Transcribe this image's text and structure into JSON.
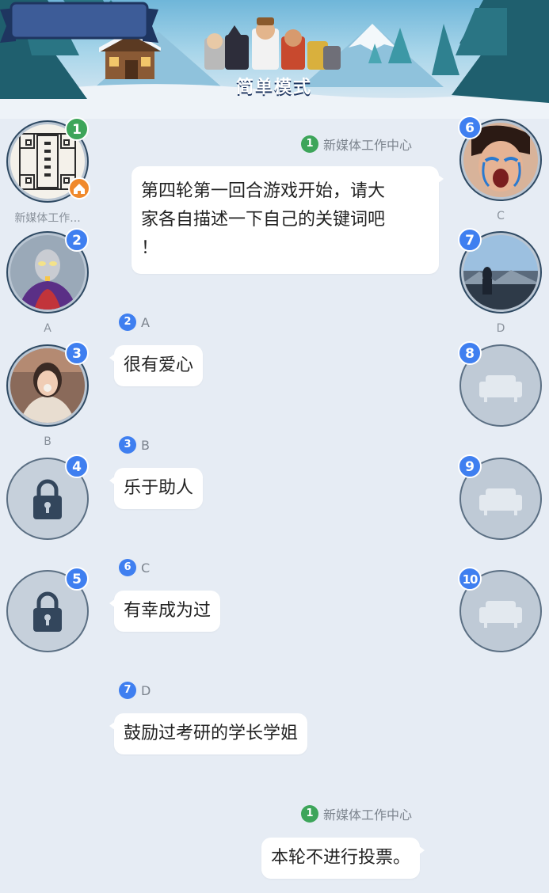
{
  "header": {
    "mode_title": "简单模式"
  },
  "seats_left": [
    {
      "number": "1",
      "label": "新媒体工作...",
      "badge_color": "#3da55a",
      "state": "avatar",
      "avatar": "host-logo-icon",
      "is_host": true
    },
    {
      "number": "2",
      "label": "A",
      "badge_color": "#3f7ff0",
      "state": "avatar",
      "avatar": "hero-avatar-icon"
    },
    {
      "number": "3",
      "label": "B",
      "badge_color": "#3f7ff0",
      "state": "avatar",
      "avatar": "girl-avatar-icon"
    },
    {
      "number": "4",
      "label": "",
      "badge_color": "#3f7ff0",
      "state": "locked",
      "avatar": "lock-icon"
    },
    {
      "number": "5",
      "label": "",
      "badge_color": "#3f7ff0",
      "state": "locked",
      "avatar": "lock-icon"
    }
  ],
  "seats_right": [
    {
      "number": "6",
      "label": "C",
      "badge_color": "#3f7ff0",
      "state": "avatar",
      "avatar": "crying-face-avatar-icon"
    },
    {
      "number": "7",
      "label": "D",
      "badge_color": "#3f7ff0",
      "state": "avatar",
      "avatar": "landscape-avatar-icon"
    },
    {
      "number": "8",
      "label": "",
      "badge_color": "#3f7ff0",
      "state": "empty",
      "avatar": "sofa-icon"
    },
    {
      "number": "9",
      "label": "",
      "badge_color": "#3f7ff0",
      "state": "empty",
      "avatar": "sofa-icon"
    },
    {
      "number": "10",
      "label": "",
      "badge_color": "#3f7ff0",
      "state": "empty",
      "avatar": "sofa-icon"
    }
  ],
  "messages": [
    {
      "sender_number": "1",
      "sender_name": "新媒体工作中心",
      "text_lines": [
        "第四轮第一回合游戏开始，请大",
        "家各自描述一下自己的关键词吧",
        "！"
      ]
    },
    {
      "sender_number": "2",
      "sender_name": "A",
      "text": "很有爱心"
    },
    {
      "sender_number": "3",
      "sender_name": "B",
      "text": "乐于助人"
    },
    {
      "sender_number": "6",
      "sender_name": "C",
      "text": "有幸成为过"
    },
    {
      "sender_number": "7",
      "sender_name": "D",
      "text": "鼓励过考研的学长学姐"
    },
    {
      "sender_number": "1",
      "sender_name": "新媒体工作中心",
      "text": "本轮不进行投票。"
    }
  ],
  "colors": {
    "background": "#e6ecf4",
    "seat_badge_blue": "#3f7ff0",
    "host_badge_green": "#3da55a",
    "home_badge_orange": "#f0892c"
  }
}
